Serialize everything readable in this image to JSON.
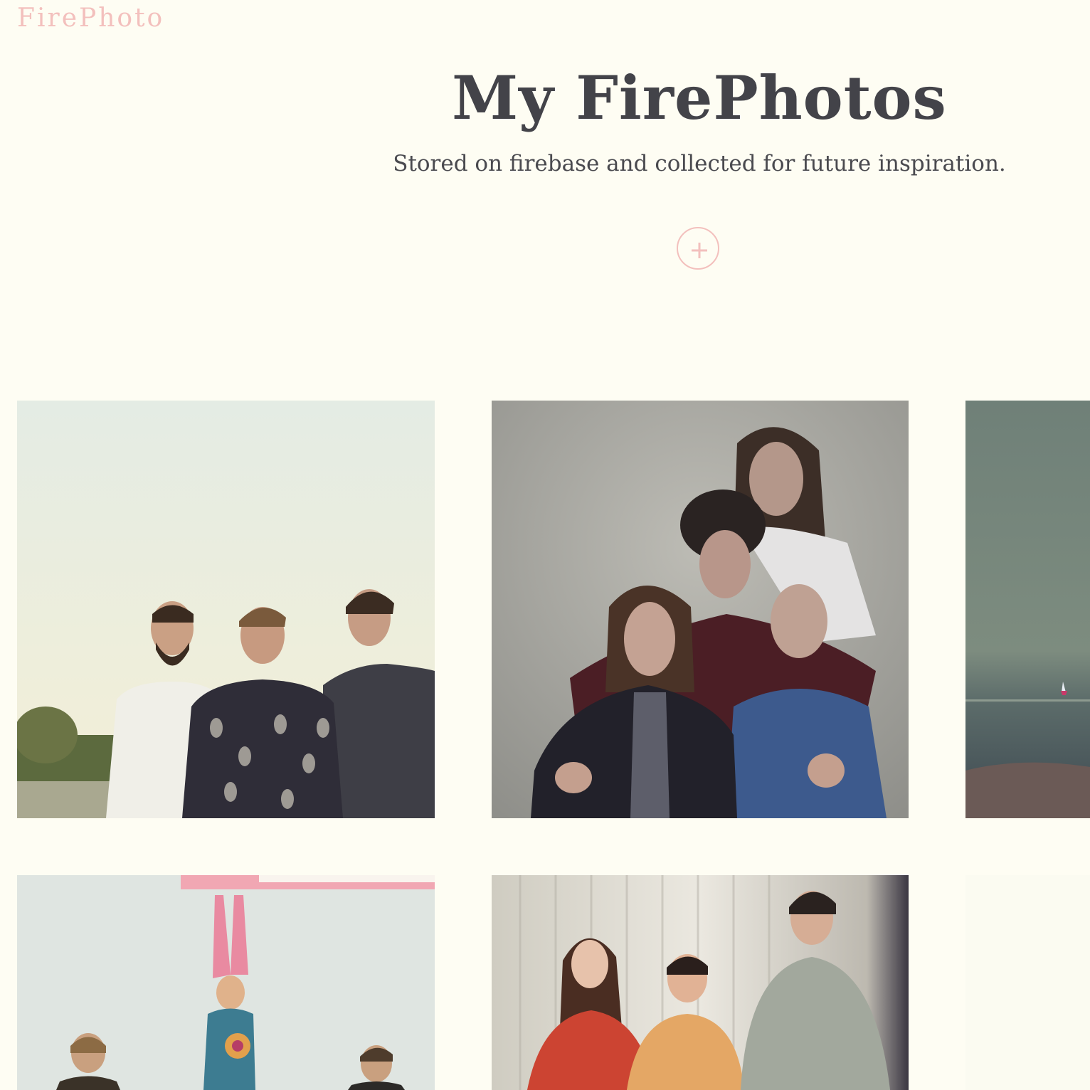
{
  "header": {
    "brand": "FirePhoto"
  },
  "hero": {
    "title": "My FirePhotos",
    "subtitle": "Stored on firebase and collected for future inspiration."
  },
  "actions": {
    "add_icon": "plus-icon"
  },
  "colors": {
    "background": "#fefdf3",
    "accent": "#f3c0bd",
    "title_text": "#434349"
  },
  "gallery": {
    "photos": [
      {
        "description": "three men standing outdoors at sunset by water"
      },
      {
        "description": "four men posed against grey backdrop"
      },
      {
        "description": "dim blue-green seascape with a small sailboat"
      },
      {
        "description": "band posing with a person hanging from a pink board"
      },
      {
        "description": "four band members in front of a curtain"
      },
      {
        "description": "empty placeholder"
      }
    ]
  }
}
